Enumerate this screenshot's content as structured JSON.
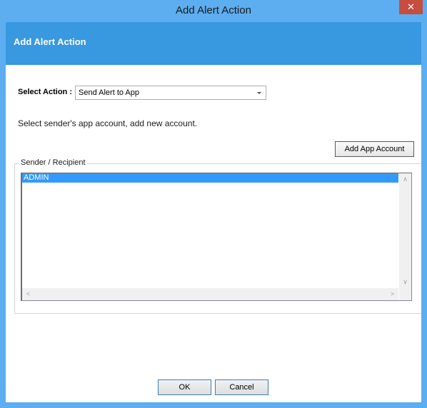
{
  "window": {
    "title": "Add Alert Action",
    "close_glyph": "✕"
  },
  "header": {
    "title": "Add Alert Action"
  },
  "action": {
    "label": "Select Action :",
    "selected_value": "Send Alert to App"
  },
  "instruction": "Select sender's app account, add new account.",
  "add_account_label": "Add App Account",
  "sender_group": {
    "legend": "Sender / Recipient",
    "items": [
      {
        "label": "ADMIN",
        "selected": true
      }
    ]
  },
  "scroll_glyphs": {
    "up": "∧",
    "down": "∨",
    "left": "<",
    "right": ">"
  },
  "footer": {
    "ok_label": "OK",
    "cancel_label": "Cancel"
  },
  "colors": {
    "titlebar": "#5caef0",
    "header_band": "#3898e0",
    "close_button": "#c74d3f",
    "selection": "#3399ff"
  }
}
